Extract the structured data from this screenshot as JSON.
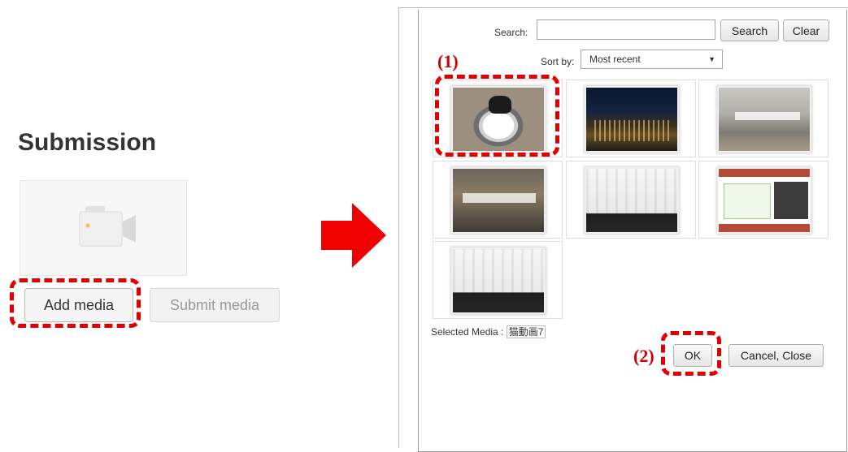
{
  "submission": {
    "title": "Submission",
    "add_media_label": "Add media",
    "submit_media_label": "Submit media"
  },
  "dialog": {
    "search_label": "Search:",
    "search_value": "",
    "search_button": "Search",
    "clear_button": "Clear",
    "sort_label": "Sort by:",
    "sort_selected": "Most recent",
    "selected_media_label": "Selected Media :",
    "selected_media_value": "猫動画7",
    "ok_button": "OK",
    "cancel_button": "Cancel, Close"
  },
  "annotations": {
    "step1": "(1)",
    "step2": "(2)"
  },
  "colors": {
    "highlight": "#e00000",
    "arrow": "#f00000"
  }
}
